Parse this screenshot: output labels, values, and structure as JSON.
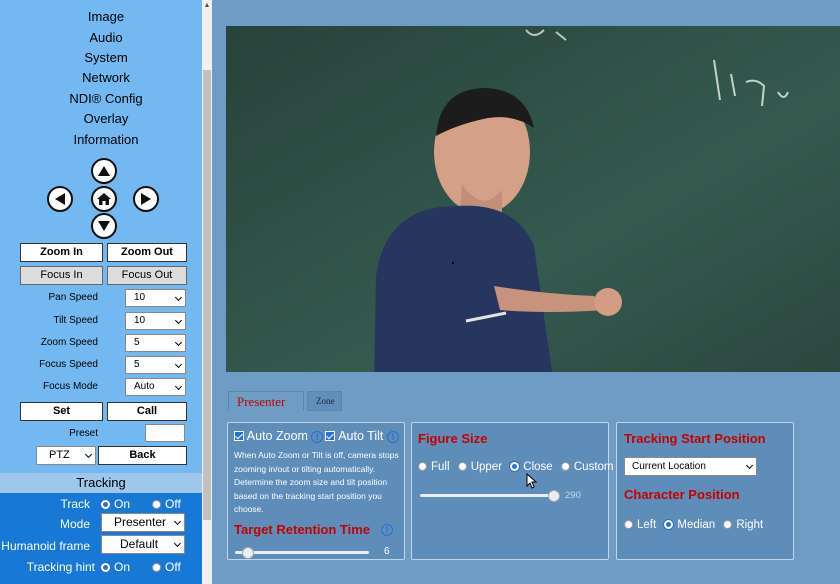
{
  "menu": [
    "Image",
    "Audio",
    "System",
    "Network",
    "NDI® Config",
    "Overlay",
    "Information"
  ],
  "ptz_buttons": {
    "zoom_in": "Zoom In",
    "zoom_out": "Zoom Out",
    "focus_in": "Focus In",
    "focus_out": "Focus Out"
  },
  "speeds": [
    {
      "label": "Pan Speed",
      "value": "10"
    },
    {
      "label": "Tilt Speed",
      "value": "10"
    },
    {
      "label": "Zoom Speed",
      "value": "5"
    },
    {
      "label": "Focus Speed",
      "value": "5"
    },
    {
      "label": "Focus Mode",
      "value": "Auto"
    }
  ],
  "preset": {
    "set_label": "Set",
    "call_label": "Call",
    "preset_label": "Preset",
    "preset_value": "",
    "mode_value": "PTZ",
    "back_label": "Back"
  },
  "tracking": {
    "header": "Tracking",
    "track_label": "Track",
    "track_on": "On",
    "track_off": "Off",
    "mode_label": "Mode",
    "mode_value": "Presenter",
    "humanoid_label": "Humanoid frame",
    "humanoid_value": "Default",
    "hint_label": "Tracking hint",
    "hint_on": "On",
    "hint_off": "Off"
  },
  "tabs": {
    "presenter": "Presenter",
    "zone": "Zone"
  },
  "presenter": {
    "auto_zoom": "Auto Zoom",
    "auto_tilt": "Auto Tilt",
    "description": "When Auto Zoom or Tilt is off, camera stops zooming in/out or tilting automatically. Determine the zoom size and tilt position based on the tracking start position you choose.",
    "retention_title": "Target Retention Time",
    "retention_value": "6",
    "retention_fraction": 0.1,
    "figure_title": "Figure Size",
    "figure_options": [
      "Full",
      "Upper",
      "Close",
      "Custom"
    ],
    "figure_selected": "Close",
    "figure_value": "290",
    "figure_fraction": 1.0,
    "start_title": "Tracking Start Position",
    "start_value": "Current Location",
    "char_title": "Character Position",
    "char_options": [
      "Left",
      "Median",
      "Right"
    ],
    "char_selected": "Median"
  },
  "colors": {
    "sidebar": "#74b8f2",
    "tracking_bg": "#1878d6",
    "panel_bg": "#6e9cc4",
    "title_red": "#c80000"
  },
  "icons": [
    "arrow-up-icon",
    "arrow-left-icon",
    "home-icon",
    "arrow-right-icon",
    "arrow-down-icon",
    "info-icon",
    "chevron-down-icon"
  ]
}
